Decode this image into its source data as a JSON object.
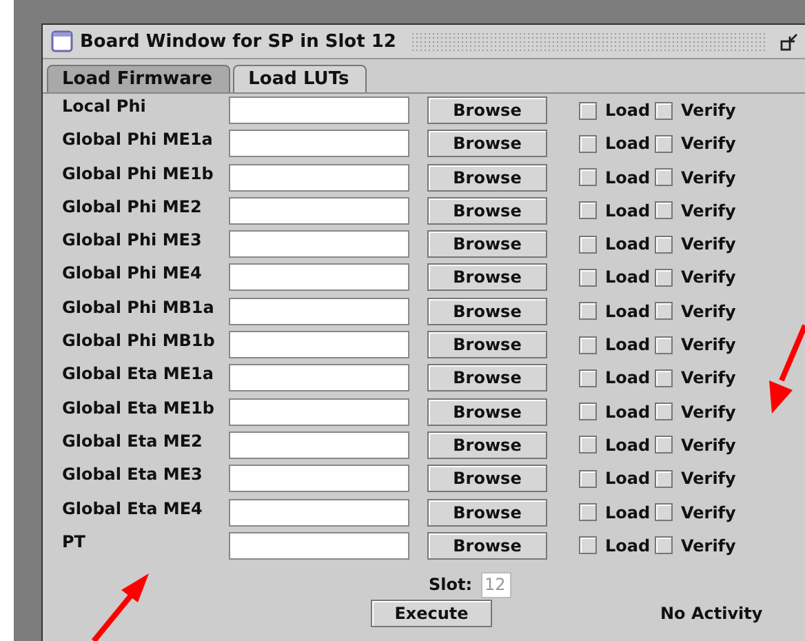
{
  "window": {
    "title": "Board Window for SP in Slot 12"
  },
  "tabs": [
    {
      "label": "Load Firmware",
      "selected": false
    },
    {
      "label": "Load LUTs",
      "selected": true
    }
  ],
  "rows": [
    {
      "label": "Local Phi",
      "button": "Browse",
      "load": {
        "label": "Load",
        "checked": false
      },
      "verify": {
        "label": "Verify",
        "checked": false
      }
    },
    {
      "label": "Global Phi ME1a",
      "button": "Browse",
      "load": {
        "label": "Load",
        "checked": false
      },
      "verify": {
        "label": "Verify",
        "checked": false
      }
    },
    {
      "label": "Global Phi ME1b",
      "button": "Browse",
      "load": {
        "label": "Load",
        "checked": false
      },
      "verify": {
        "label": "Verify",
        "checked": false
      }
    },
    {
      "label": "Global Phi ME2",
      "button": "Browse",
      "load": {
        "label": "Load",
        "checked": false
      },
      "verify": {
        "label": "Verify",
        "checked": false
      }
    },
    {
      "label": "Global Phi ME3",
      "button": "Browse",
      "load": {
        "label": "Load",
        "checked": false
      },
      "verify": {
        "label": "Verify",
        "checked": false
      }
    },
    {
      "label": "Global Phi ME4",
      "button": "Browse",
      "load": {
        "label": "Load",
        "checked": false
      },
      "verify": {
        "label": "Verify",
        "checked": false
      }
    },
    {
      "label": "Global Phi MB1a",
      "button": "Browse",
      "load": {
        "label": "Load",
        "checked": false
      },
      "verify": {
        "label": "Verify",
        "checked": false
      }
    },
    {
      "label": "Global Phi MB1b",
      "button": "Browse",
      "load": {
        "label": "Load",
        "checked": false
      },
      "verify": {
        "label": "Verify",
        "checked": false
      }
    },
    {
      "label": "Global Eta ME1a",
      "button": "Browse",
      "load": {
        "label": "Load",
        "checked": false
      },
      "verify": {
        "label": "Verify",
        "checked": false
      }
    },
    {
      "label": "Global Eta ME1b",
      "button": "Browse",
      "load": {
        "label": "Load",
        "checked": false
      },
      "verify": {
        "label": "Verify",
        "checked": false
      }
    },
    {
      "label": "Global Eta ME2",
      "button": "Browse",
      "load": {
        "label": "Load",
        "checked": false
      },
      "verify": {
        "label": "Verify",
        "checked": false
      }
    },
    {
      "label": "Global Eta ME3",
      "button": "Browse",
      "load": {
        "label": "Load",
        "checked": false
      },
      "verify": {
        "label": "Verify",
        "checked": false
      }
    },
    {
      "label": "Global Eta ME4",
      "button": "Browse",
      "load": {
        "label": "Load",
        "checked": false
      },
      "verify": {
        "label": "Verify",
        "checked": false
      }
    },
    {
      "label": "PT",
      "button": "Browse",
      "load": {
        "label": "Load",
        "checked": false
      },
      "verify": {
        "label": "Verify",
        "checked": false
      }
    }
  ],
  "slot": {
    "label": "Slot:",
    "value": "12",
    "disabled": true
  },
  "execute_button": "Execute",
  "status": "No Activity"
}
